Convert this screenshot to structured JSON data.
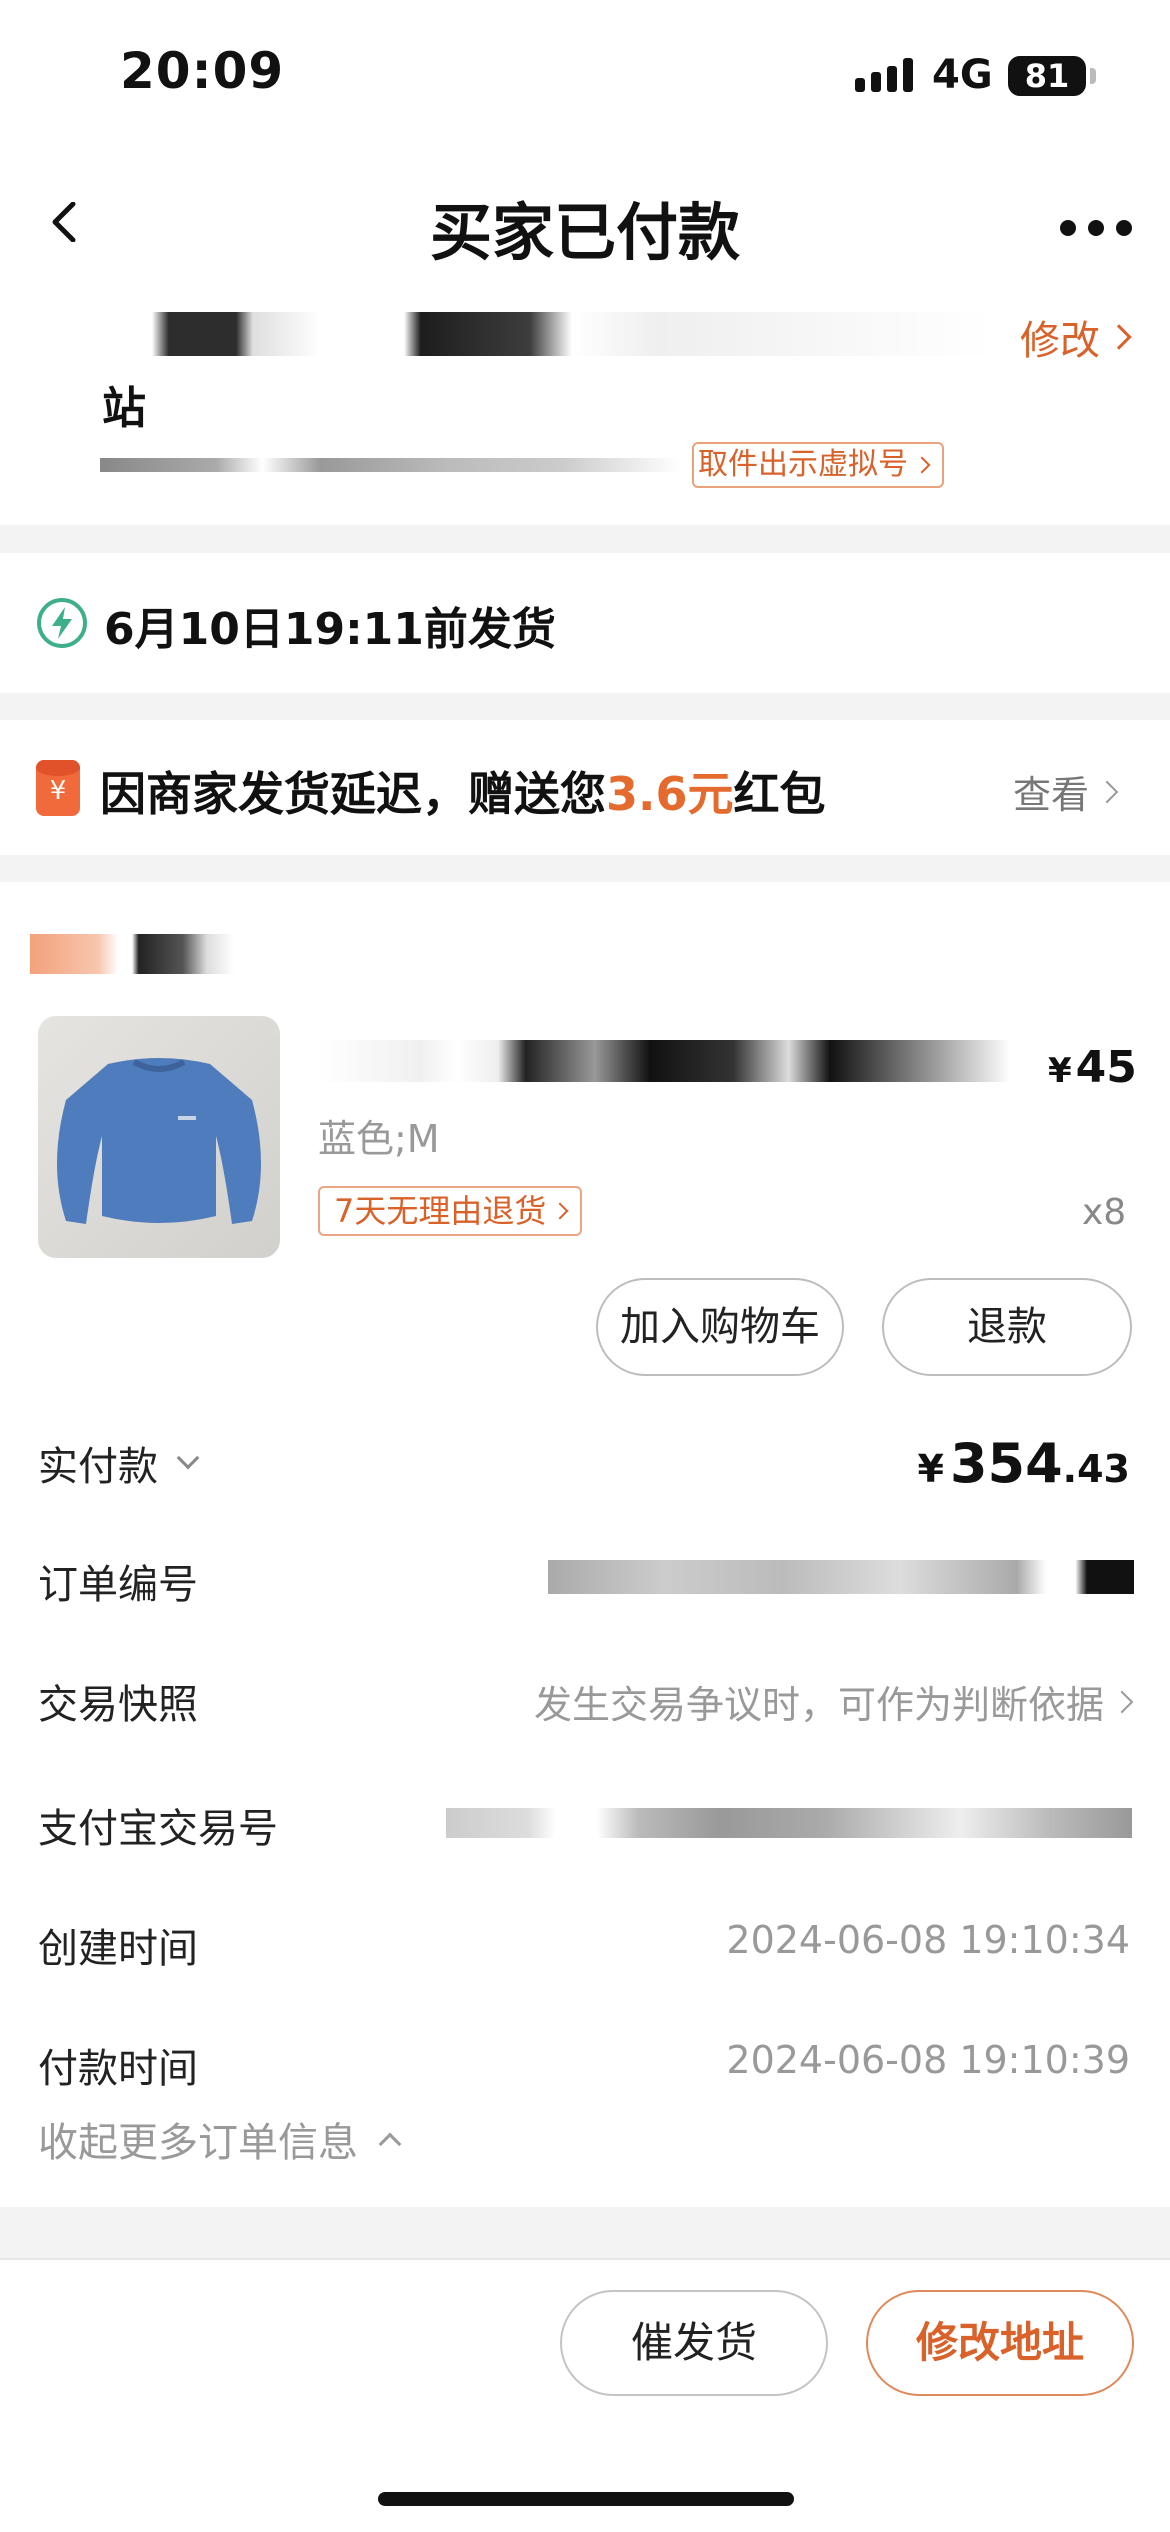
{
  "status_bar": {
    "time": "20:09",
    "network": "4G",
    "battery": "81"
  },
  "nav": {
    "title": "买家已付款"
  },
  "address": {
    "edit_label": "修改",
    "line2": "站",
    "virtual_number_label": "取件出示虚拟号"
  },
  "shipping": {
    "deadline_text": "6月10日19:11前发货"
  },
  "red_packet": {
    "text_before": "因商家发货延迟，赠送您",
    "amount": "3.6元",
    "text_after": "红包",
    "view_label": "查看"
  },
  "product": {
    "price_symbol": "¥",
    "price": "45",
    "spec": "蓝色;M",
    "return_policy": "7天无理由退货",
    "quantity": "x8",
    "add_to_cart_label": "加入购物车",
    "refund_label": "退款"
  },
  "order_info": {
    "paid_label": "实付款",
    "paid_currency": "¥",
    "paid_integer": "354",
    "paid_decimal": ".43",
    "order_no_label": "订单编号",
    "snapshot_label": "交易快照",
    "snapshot_value": "发生交易争议时，可作为判断依据",
    "alipay_no_label": "支付宝交易号",
    "created_label": "创建时间",
    "created_value": "2024-06-08 19:10:34",
    "paid_time_label": "付款时间",
    "paid_time_value": "2024-06-08 19:10:39",
    "collapse_label": "收起更多订单信息"
  },
  "actions": {
    "urge_label": "催发货",
    "edit_address_label": "修改地址"
  },
  "colors": {
    "accent": "#d9612a",
    "background": "#f3f3f3"
  }
}
